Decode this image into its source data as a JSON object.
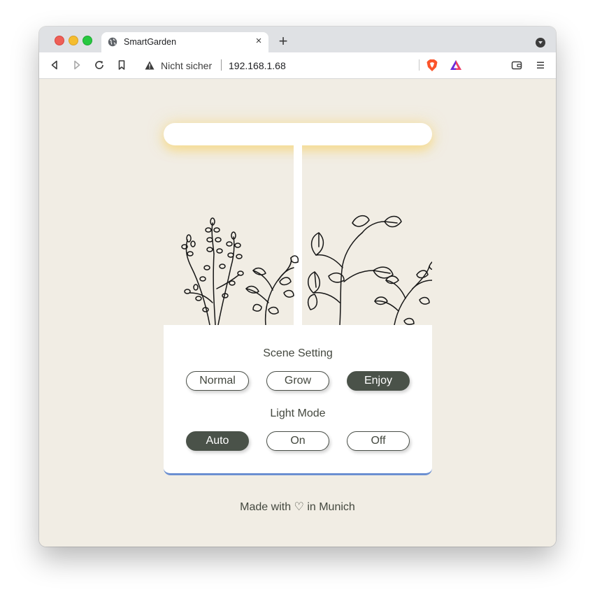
{
  "browser": {
    "tab_title": "SmartGarden",
    "tab_close": "×",
    "new_tab": "+",
    "security_label": "Nicht sicher",
    "url": "192.168.1.68"
  },
  "panel": {
    "scene_title": "Scene Setting",
    "scene_options": [
      "Normal",
      "Grow",
      "Enjoy"
    ],
    "scene_selected": "Enjoy",
    "light_title": "Light Mode",
    "light_options": [
      "Auto",
      "On",
      "Off"
    ],
    "light_selected": "Auto",
    "accent_color": "#6b8fd1",
    "active_color": "#4a5249"
  },
  "footer": {
    "text": "Made with ♡ in Munich"
  }
}
